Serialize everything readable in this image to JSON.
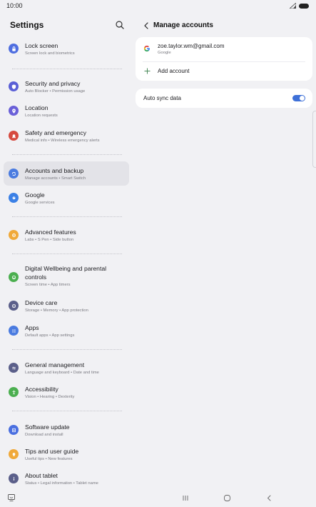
{
  "status_bar": {
    "time": "10:00"
  },
  "settings": {
    "title": "Settings",
    "items": [
      {
        "title": "Lock screen",
        "subtitle": "Screen lock and biometrics",
        "icon": "lock-icon",
        "color": "#4f6ee0"
      },
      {
        "title": "Security and privacy",
        "subtitle": "Auto Blocker  •  Permission usage",
        "icon": "shield-icon",
        "color": "#5a5fd6"
      },
      {
        "title": "Location",
        "subtitle": "Location requests",
        "icon": "location-pin-icon",
        "color": "#6a60d8"
      },
      {
        "title": "Safety and emergency",
        "subtitle": "Medical info  •  Wireless emergency alerts",
        "icon": "alert-bell-icon",
        "color": "#d64a3f"
      },
      {
        "title": "Accounts and backup",
        "subtitle": "Manage accounts  •  Smart Switch",
        "icon": "sync-icon",
        "color": "#4a7be0"
      },
      {
        "title": "Google",
        "subtitle": "Google services",
        "icon": "google-icon",
        "color": "#3b80e6"
      },
      {
        "title": "Advanced features",
        "subtitle": "Labs  •  S Pen  •  Side button",
        "icon": "star-gear-icon",
        "color": "#f0a93a"
      },
      {
        "title": "Digital Wellbeing and parental",
        "title2": "controls",
        "subtitle": "Screen time  •  App timers",
        "icon": "wellbeing-icon",
        "color": "#4caf50"
      },
      {
        "title": "Device care",
        "subtitle": "Storage  •  Memory  •  App protection",
        "icon": "device-care-icon",
        "color": "#5b5f8a"
      },
      {
        "title": "Apps",
        "subtitle": "Default apps  •  App settings",
        "icon": "apps-grid-icon",
        "color": "#4a7be0"
      },
      {
        "title": "General management",
        "subtitle": "Language and keyboard  •  Date and time",
        "icon": "sliders-icon",
        "color": "#5b5f8a"
      },
      {
        "title": "Accessibility",
        "subtitle": "Vision  •  Hearing  •  Dexterity",
        "icon": "accessibility-icon",
        "color": "#4caf50"
      },
      {
        "title": "Software update",
        "subtitle": "Download and install",
        "icon": "update-icon",
        "color": "#4a6fe0"
      },
      {
        "title": "Tips and user guide",
        "subtitle": "Useful tips  •  New features",
        "icon": "lightbulb-icon",
        "color": "#f0a93a"
      },
      {
        "title": "About tablet",
        "subtitle": "Status  •  Legal information  •  Tablet name",
        "icon": "info-icon",
        "color": "#5b5f8a"
      }
    ]
  },
  "manage_accounts": {
    "title": "Manage accounts",
    "account": {
      "email": "zoe.taylor.wm@gmail.com",
      "provider": "Google"
    },
    "add_account_label": "Add account",
    "auto_sync_label": "Auto sync data",
    "auto_sync_enabled": true
  },
  "colors": {
    "accent": "#3e70d8",
    "background": "#f1f1f4",
    "active_item": "#e3e3e8"
  }
}
